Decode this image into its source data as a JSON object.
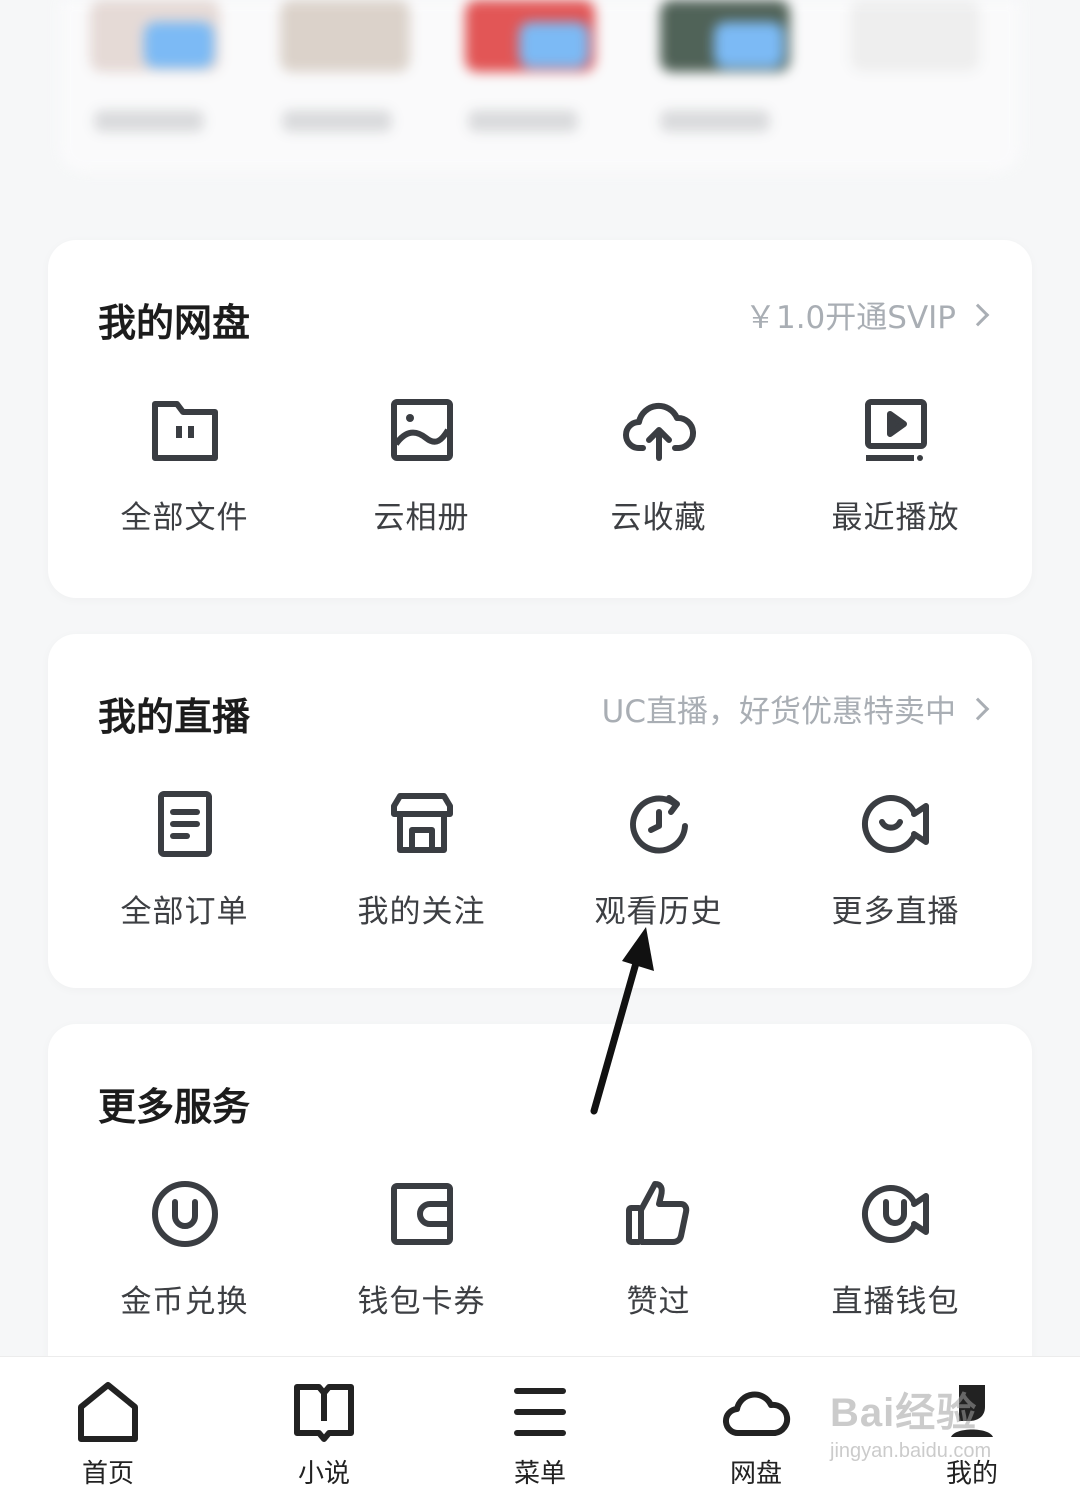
{
  "colors": {
    "background": "#f6f7f8",
    "card": "#ffffff",
    "icon": "#3a3d42",
    "muted": "#a9aeb4"
  },
  "netdisk": {
    "title": "我的网盘",
    "promo_link": "￥1.0开通SVIP",
    "items": [
      {
        "label": "全部文件",
        "icon": "folder-icon"
      },
      {
        "label": "云相册",
        "icon": "photo-album-icon"
      },
      {
        "label": "云收藏",
        "icon": "cloud-upload-icon"
      },
      {
        "label": "最近播放",
        "icon": "recent-play-icon"
      }
    ]
  },
  "live": {
    "title": "我的直播",
    "promo_link": "UC直播，好货优惠特卖中",
    "items": [
      {
        "label": "全部订单",
        "icon": "order-document-icon"
      },
      {
        "label": "我的关注",
        "icon": "storefront-icon"
      },
      {
        "label": "观看历史",
        "icon": "watch-history-icon"
      },
      {
        "label": "更多直播",
        "icon": "live-camera-icon"
      }
    ]
  },
  "services": {
    "title": "更多服务",
    "items": [
      {
        "label": "金币兑换",
        "icon": "coin-u-icon"
      },
      {
        "label": "钱包卡券",
        "icon": "wallet-icon"
      },
      {
        "label": "赞过",
        "icon": "thumbs-up-icon"
      },
      {
        "label": "直播钱包",
        "icon": "live-wallet-icon"
      }
    ]
  },
  "bottom_nav": [
    {
      "label": "首页",
      "icon": "home-icon"
    },
    {
      "label": "小说",
      "icon": "book-icon"
    },
    {
      "label": "菜单",
      "icon": "menu-icon"
    },
    {
      "label": "网盘",
      "icon": "cloud-icon"
    },
    {
      "label": "我的",
      "icon": "profile-icon"
    }
  ],
  "watermark": {
    "main": "Bai经验",
    "sub": "jingyan.baidu.com"
  }
}
